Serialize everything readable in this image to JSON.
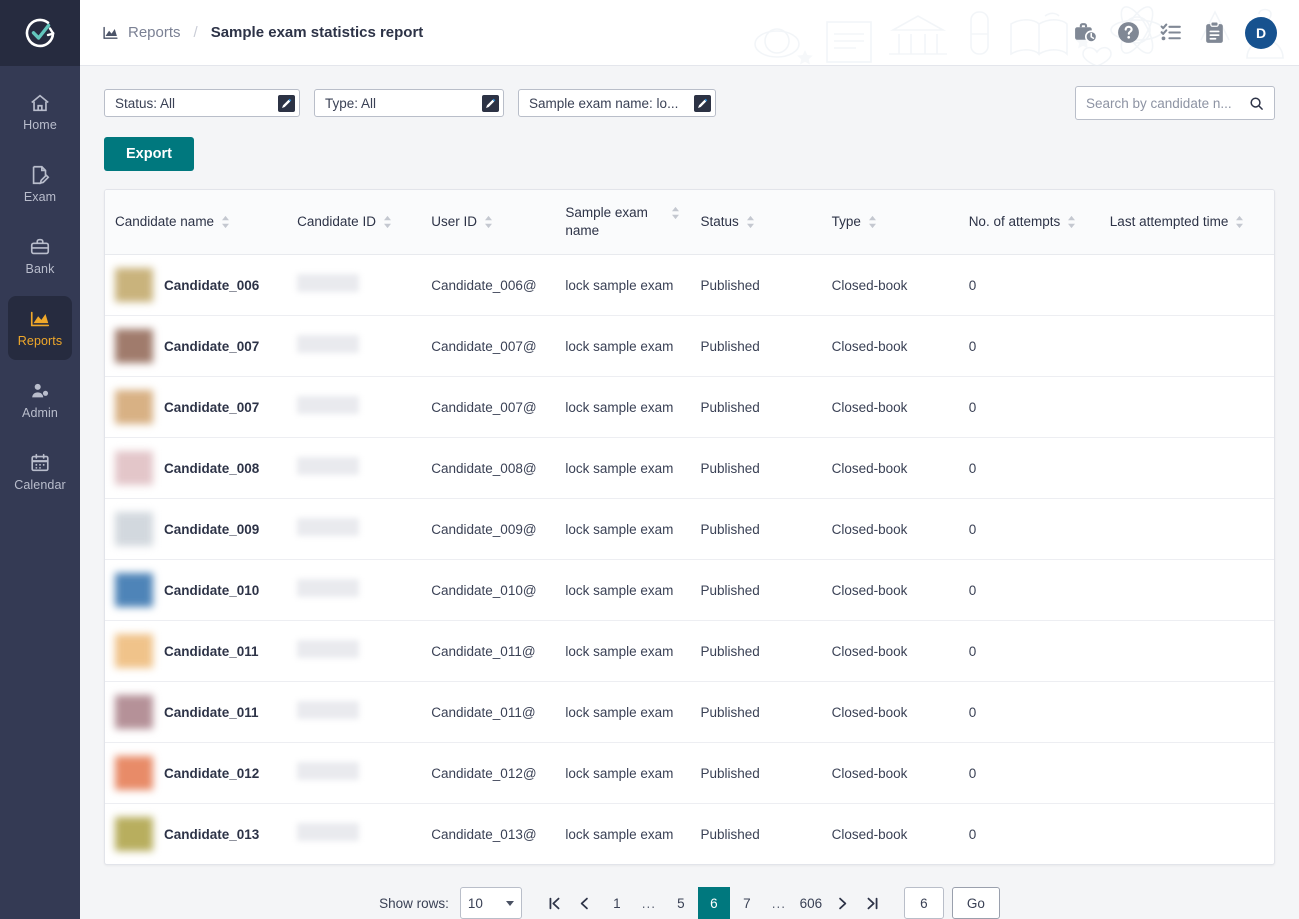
{
  "brand": {
    "logo_icon": "check-circle-arrow-logo",
    "accent_teal": "#00787e",
    "sidebar_bg": "#343a54",
    "active_nav_color": "#f0a82a"
  },
  "sidebar": {
    "items": [
      {
        "label": "Home",
        "icon": "home-icon",
        "active": false
      },
      {
        "label": "Exam",
        "icon": "exam-icon",
        "active": false
      },
      {
        "label": "Bank",
        "icon": "bank-icon",
        "active": false
      },
      {
        "label": "Reports",
        "icon": "reports-icon",
        "active": true
      },
      {
        "label": "Admin",
        "icon": "admin-icon",
        "active": false
      },
      {
        "label": "Calendar",
        "icon": "calendar-icon",
        "active": false
      }
    ]
  },
  "header": {
    "breadcrumb": {
      "icon": "chart-icon",
      "parent": "Reports",
      "separator": "/",
      "current": "Sample exam statistics report"
    },
    "icons": [
      "briefcase-clock-icon",
      "help-circle-icon",
      "checklist-icon",
      "clipboard-icon"
    ],
    "avatar_initial": "D",
    "avatar_color": "#17528f"
  },
  "filters": [
    {
      "label": "Status: All",
      "action_icon": "pencil-icon"
    },
    {
      "label": "Type: All",
      "action_icon": "pencil-icon"
    },
    {
      "label": "Sample exam name: lo...",
      "action_icon": "pencil-icon"
    }
  ],
  "search": {
    "placeholder": "Search by candidate n...",
    "value": "",
    "icon": "search-icon"
  },
  "toolbar": {
    "export_label": "Export"
  },
  "table": {
    "columns": [
      {
        "label": "Candidate name",
        "sortable": true
      },
      {
        "label": "Candidate ID",
        "sortable": true
      },
      {
        "label": "User ID",
        "sortable": true
      },
      {
        "label": "Sample exam name",
        "sortable": true
      },
      {
        "label": "Status",
        "sortable": true
      },
      {
        "label": "Type",
        "sortable": true
      },
      {
        "label": "No. of attempts",
        "sortable": true
      },
      {
        "label": "Last attempted time",
        "sortable": true
      }
    ],
    "rows": [
      {
        "name": "Candidate_006",
        "avatar_color": "#c9b37c",
        "candidate_id": "",
        "user_id": "Candidate_006@",
        "exam_name": "lock sample exam",
        "status": "Published",
        "type": "Closed-book",
        "attempts": "0",
        "last_attempted": ""
      },
      {
        "name": "Candidate_007",
        "avatar_color": "#a07b6c",
        "candidate_id": "",
        "user_id": "Candidate_007@",
        "exam_name": "lock sample exam",
        "status": "Published",
        "type": "Closed-book",
        "attempts": "0",
        "last_attempted": ""
      },
      {
        "name": "Candidate_007",
        "avatar_color": "#d8b184",
        "candidate_id": "",
        "user_id": "Candidate_007@",
        "exam_name": "lock sample exam",
        "status": "Published",
        "type": "Closed-book",
        "attempts": "0",
        "last_attempted": ""
      },
      {
        "name": "Candidate_008",
        "avatar_color": "#e3c6c9",
        "candidate_id": "",
        "user_id": "Candidate_008@",
        "exam_name": "lock sample exam",
        "status": "Published",
        "type": "Closed-book",
        "attempts": "0",
        "last_attempted": ""
      },
      {
        "name": "Candidate_009",
        "avatar_color": "#d2d8de",
        "candidate_id": "",
        "user_id": "Candidate_009@",
        "exam_name": "lock sample exam",
        "status": "Published",
        "type": "Closed-book",
        "attempts": "0",
        "last_attempted": ""
      },
      {
        "name": "Candidate_010",
        "avatar_color": "#4e84b8",
        "candidate_id": "",
        "user_id": "Candidate_010@",
        "exam_name": "lock sample exam",
        "status": "Published",
        "type": "Closed-book",
        "attempts": "0",
        "last_attempted": ""
      },
      {
        "name": "Candidate_011",
        "avatar_color": "#f0c38a",
        "candidate_id": "",
        "user_id": "Candidate_011@",
        "exam_name": "lock sample exam",
        "status": "Published",
        "type": "Closed-book",
        "attempts": "0",
        "last_attempted": ""
      },
      {
        "name": "Candidate_011",
        "avatar_color": "#b59198",
        "candidate_id": "",
        "user_id": "Candidate_011@",
        "exam_name": "lock sample exam",
        "status": "Published",
        "type": "Closed-book",
        "attempts": "0",
        "last_attempted": ""
      },
      {
        "name": "Candidate_012",
        "avatar_color": "#e88b68",
        "candidate_id": "",
        "user_id": "Candidate_012@",
        "exam_name": "lock sample exam",
        "status": "Published",
        "type": "Closed-book",
        "attempts": "0",
        "last_attempted": ""
      },
      {
        "name": "Candidate_013",
        "avatar_color": "#b8ae5e",
        "candidate_id": "",
        "user_id": "Candidate_013@",
        "exam_name": "lock sample exam",
        "status": "Published",
        "type": "Closed-book",
        "attempts": "0",
        "last_attempted": ""
      }
    ]
  },
  "pagination": {
    "show_rows_label": "Show rows:",
    "rows_per_page": "10",
    "first_icon": "first-page-icon",
    "prev_icon": "prev-page-icon",
    "next_icon": "next-page-icon",
    "last_icon": "last-page-icon",
    "pages": [
      "1",
      "...",
      "5",
      "6",
      "7",
      "...",
      "606"
    ],
    "active_page": "6",
    "goto_value": "6",
    "go_label": "Go"
  }
}
